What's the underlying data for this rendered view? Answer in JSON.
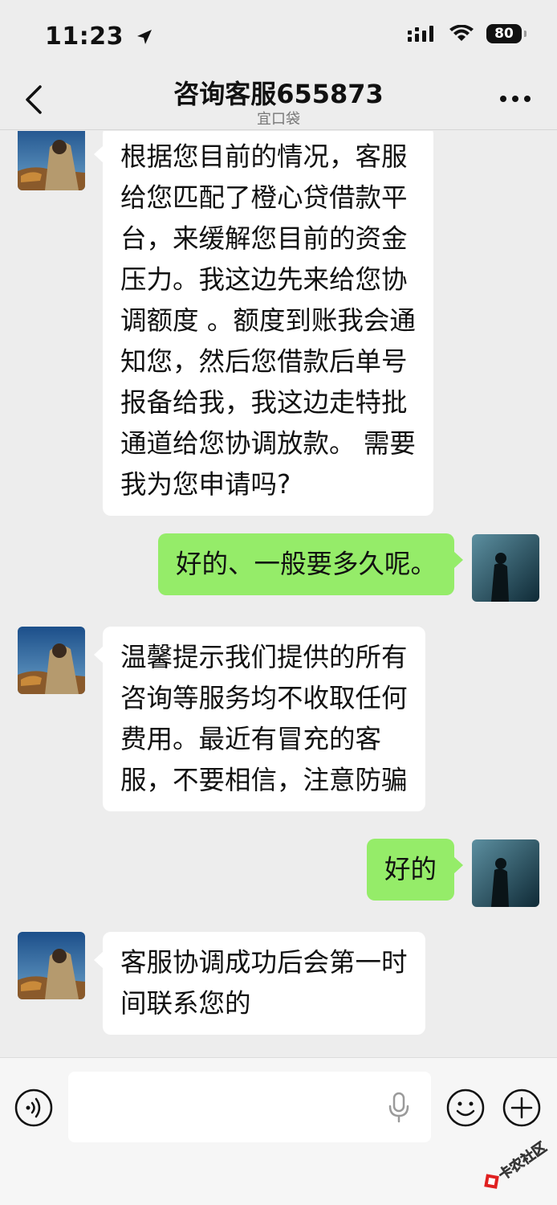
{
  "status_bar": {
    "time": "11:23",
    "battery": "80"
  },
  "nav": {
    "title": "咨询客服655873",
    "subtitle": "宜口袋"
  },
  "messages": [
    {
      "side": "left",
      "lines": [
        "根据您目前的情况，客服",
        "给您匹配了橙心贷借款平",
        "台，来缓解您目前的资金",
        "压力。我这边先来给您协",
        "调额度 。额度到账我会通",
        "知您，然后您借款后单号",
        "报备给我，我这边走特批",
        "通道给您协调放款。 需要",
        "我为您申请吗?"
      ]
    },
    {
      "side": "right",
      "lines": [
        "好的、一般要多久呢。"
      ]
    },
    {
      "side": "left",
      "lines": [
        "温馨提示我们提供的所有",
        "咨询等服务均不收取任何",
        "费用。最近有冒充的客",
        "服，不要相信，注意防骗"
      ]
    },
    {
      "side": "right",
      "lines": [
        "好的"
      ]
    },
    {
      "side": "left",
      "lines": [
        "客服协调成功后会第一时",
        "间联系您的"
      ]
    }
  ],
  "input": {
    "placeholder": ""
  },
  "watermark": {
    "text": "卡农社区"
  },
  "colors": {
    "background": "#ededed",
    "bubble_self": "#95ec69",
    "bubble_other": "#ffffff"
  },
  "icons": {
    "back": "chevron-left-icon",
    "more": "more-icon",
    "voice": "voice-icon",
    "mic": "mic-icon",
    "emoji": "emoji-icon",
    "plus": "plus-icon"
  }
}
